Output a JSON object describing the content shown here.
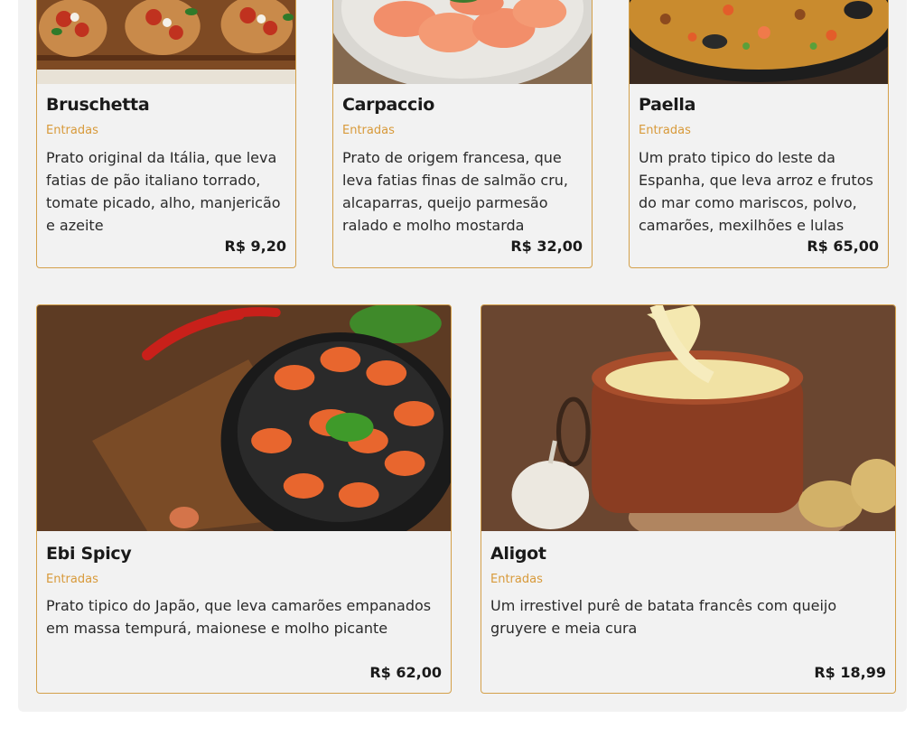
{
  "currency_color": "#d89a3a",
  "cards": [
    {
      "title": "Bruschetta",
      "category": "Entradas",
      "description": "Prato original da Itália, que leva fatias de pão italiano torrado, tomate picado, alho, manjericão e azeite",
      "price": "R$ 9,20",
      "image": "bruschetta-photo"
    },
    {
      "title": "Carpaccio",
      "category": "Entradas",
      "description": "Prato de origem francesa, que leva fatias finas de salmão cru, alcaparras, queijo parmesão ralado e molho mostarda",
      "price": "R$ 32,00",
      "image": "carpaccio-photo"
    },
    {
      "title": "Paella",
      "category": "Entradas",
      "description": "Um prato tipico do leste da Espanha, que leva arroz e frutos do mar como mariscos, polvo, camarões, mexilhões e lulas",
      "price": "R$ 65,00",
      "image": "paella-photo"
    },
    {
      "title": "Ebi Spicy",
      "category": "Entradas",
      "description": "Prato tipico do Japão, que leva camarões empanados em massa tempurá, maionese e molho picante",
      "price": "R$ 62,00",
      "image": "ebi-spicy-photo"
    },
    {
      "title": "Aligot",
      "category": "Entradas",
      "description": "Um irrestivel purê de batata francês com queijo gruyere e meia cura",
      "price": "R$ 18,99",
      "image": "aligot-photo"
    }
  ]
}
